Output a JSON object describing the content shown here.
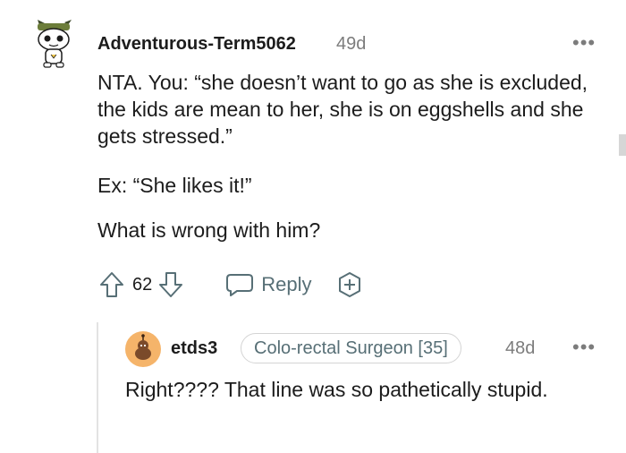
{
  "comment": {
    "username": "Adventurous-Term5062",
    "age": "49d",
    "more_icon": "more-horizontal-icon",
    "paragraphs": [
      "NTA. You: “she doesn’t want to go as she is excluded, the kids are mean to her, she is on eggshells and she gets stressed.”",
      "Ex: “She likes it!”",
      "What is wrong with him?"
    ],
    "votes": "62",
    "reply_label": "Reply"
  },
  "reply": {
    "username": "etds3",
    "flair": "Colo-rectal Surgeon [35]",
    "age": "48d",
    "text": "Right???? That line was so pathetically stupid."
  },
  "colors": {
    "text": "#1c1c1c",
    "muted": "#7c7c7c",
    "action": "#576f76",
    "avatar2_bg": "#f5b46a",
    "thread_line": "#e3e3e3"
  }
}
